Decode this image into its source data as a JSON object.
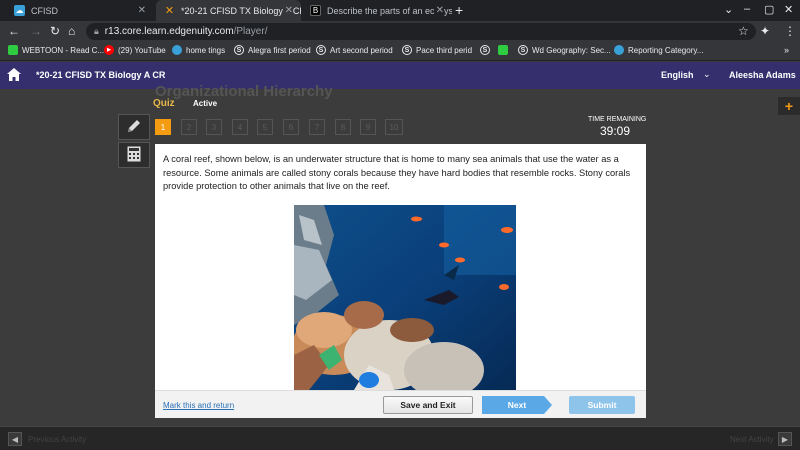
{
  "browser": {
    "tabs": [
      {
        "title": "CFISD",
        "active": false
      },
      {
        "title": "*20-21 CFISD TX Biology A CR - E",
        "active": true
      },
      {
        "title": "Describe the parts of an ecosyst",
        "active": false
      }
    ],
    "new_tab": "+",
    "address": {
      "host": "r13.core.learn.edgenuity.com",
      "path": "/Player/"
    },
    "bookmarks": [
      {
        "label": "WEBTOON - Read C...",
        "icon": "webtoon-icon",
        "color": "#2ecc40"
      },
      {
        "label": "(29) YouTube",
        "icon": "youtube-icon",
        "color": "#ff0000"
      },
      {
        "label": "home tings",
        "icon": "classroom-icon",
        "color": "#3aa0d8"
      },
      {
        "label": "Alegra first period",
        "icon": "schoology-icon",
        "color": "#e8eaed"
      },
      {
        "label": "Art second period",
        "icon": "schoology-icon",
        "color": "#e8eaed"
      },
      {
        "label": "Pace third perid",
        "icon": "schoology-icon",
        "color": "#e8eaed"
      },
      {
        "label": "",
        "icon": "schoology-icon",
        "color": "#e8eaed"
      },
      {
        "label": "",
        "icon": "webtoon-icon",
        "color": "#2ecc40"
      },
      {
        "label": "Wd Geography: Sec...",
        "icon": "schoology-icon",
        "color": "#e8eaed"
      },
      {
        "label": "Reporting Category...",
        "icon": "classroom-icon",
        "color": "#3aa0d8"
      }
    ]
  },
  "app": {
    "course_title": "*20-21 CFISD TX Biology A CR",
    "language": "English",
    "user": "Aleesha Adams"
  },
  "activity": {
    "lesson_title": "Organizational Hierarchy",
    "type_label": "Quiz",
    "status": "Active",
    "questions": [
      "1",
      "2",
      "3",
      "4",
      "5",
      "6",
      "7",
      "8",
      "9",
      "10"
    ],
    "current_question": 1,
    "time_label": "TIME REMAINING",
    "time_value": "39:09"
  },
  "question": {
    "text": "A coral reef, shown below, is an underwater structure that is home to many sea animals that use the water as a resource. Some animals are called stony corals because they have hard bodies that resemble rocks. Stony corals provide protection to other animals that live on the reef."
  },
  "footer": {
    "mark_label": "Mark this and return",
    "save_label": "Save and Exit",
    "next_label": "Next",
    "submit_label": "Submit"
  },
  "bottom": {
    "prev_label": "Previous Activity",
    "next_label": "Next Activity"
  },
  "colors": {
    "header_bg": "#35306d",
    "accent": "#f39c12",
    "next_button": "#5aa8e6",
    "submit_button": "#8ec4ea"
  }
}
